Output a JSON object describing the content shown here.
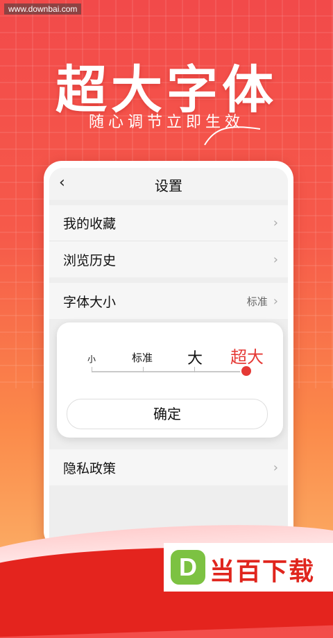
{
  "watermark": "www.downbai.com",
  "hero": {
    "title": "超大字体",
    "subtitle": "随心调节立即生效"
  },
  "settings": {
    "title": "设置",
    "back_icon": "‹",
    "items": [
      {
        "label": "我的收藏",
        "value": ""
      },
      {
        "label": "浏览历史",
        "value": ""
      },
      {
        "label": "字体大小",
        "value": "标准"
      },
      {
        "label": "隐私政策",
        "value": ""
      }
    ],
    "chevron": "›"
  },
  "font_picker": {
    "options": [
      "小",
      "标准",
      "大",
      "超大"
    ],
    "selected": "超大",
    "confirm_label": "确定"
  },
  "logo": {
    "mark": "D",
    "text": "当百下载"
  },
  "colors": {
    "accent": "#e53935",
    "logo_green": "#7cc242",
    "logo_red": "#e0251d"
  }
}
